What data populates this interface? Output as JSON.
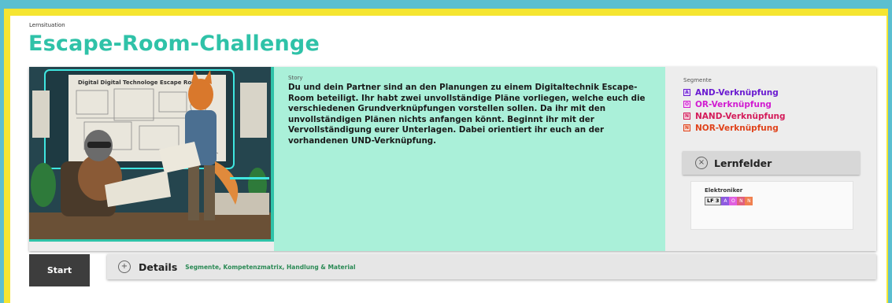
{
  "header": {
    "kicker": "Lernsituation",
    "title": "Escape-Room-Challenge"
  },
  "hero": {
    "poster_text": "Digital Digital Technologe Escape Room"
  },
  "story": {
    "label": "Story",
    "text": "Du und dein Partner sind an den Planungen zu einem Digitaltechnik Escape-Room beteiligt. Ihr habt zwei unvollständige Pläne vorliegen, welche euch die verschiedenen Grundverknüpfungen vorstellen sollen. Da ihr mit den unvollständigen Plänen nichts anfangen könnt. Beginnt ihr mit der Vervollständigung eurer Unterlagen. Dabei orientiert ihr euch an der vorhandenen UND-Verknüpfung."
  },
  "segments": {
    "label": "Segmente",
    "items": [
      {
        "label": "AND-Verknüpfung",
        "color": "#6a1bd1",
        "icon": "A"
      },
      {
        "label": "OR-Verknüpfung",
        "color": "#d11bd1",
        "icon": "O"
      },
      {
        "label": "NAND-Verknüpfung",
        "color": "#d41b5a",
        "icon": "N"
      },
      {
        "label": "NOR-Verknüpfung",
        "color": "#e0431b",
        "icon": "N"
      }
    ]
  },
  "lernfelder": {
    "label": "Lernfelder",
    "icon": "close-circle-icon",
    "panel_title": "Elektroniker",
    "code": "LF 3",
    "chips": [
      {
        "text": "A",
        "color": "#8e5be0"
      },
      {
        "text": "O",
        "color": "#e060e0"
      },
      {
        "text": "N",
        "color": "#e0607e"
      },
      {
        "text": "N",
        "color": "#f08050"
      }
    ]
  },
  "actions": {
    "start_label": "Start",
    "details_label": "Details",
    "details_sub": "Segmente, Kompetenzmatrix, Handlung & Material",
    "details_icon": "plus-circle-icon"
  },
  "colors": {
    "accent": "#2fc2a8",
    "story_bg": "#aaf0d9",
    "outer_bg": "#5bbfd0",
    "frame": "#f5e531"
  }
}
